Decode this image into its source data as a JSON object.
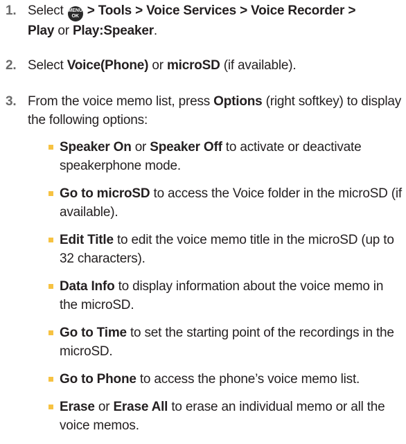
{
  "steps": [
    {
      "number": "1.",
      "pre": "Select",
      "menu_icon_label_top": "MENU",
      "menu_icon_label_bottom": "OK",
      "path": " > Tools > Voice Services > Voice Recorder >",
      "option1": "Play",
      "or": " or ",
      "option2": "Play:Speaker",
      "end": "."
    },
    {
      "number": "2.",
      "pre": "Select ",
      "option1": "Voice(Phone)",
      "or": " or ",
      "option2": "microSD",
      "end": " (if available)."
    },
    {
      "number": "3.",
      "pre": "From the voice memo list, press ",
      "key": "Options",
      "end": " (right softkey) to display the  following options:"
    }
  ],
  "options": [
    {
      "bold": "Speaker On",
      "mid": " or ",
      "bold2": "Speaker Off",
      "text": " to activate or deactivate speakerphone mode."
    },
    {
      "bold": "Go to microSD",
      "mid": "",
      "bold2": "",
      "text": " to access the Voice folder in the microSD (if available)."
    },
    {
      "bold": "Edit Title",
      "mid": "",
      "bold2": "",
      "text": " to edit the voice memo title in the microSD (up to 32 characters)."
    },
    {
      "bold": "Data Info",
      "mid": "",
      "bold2": "",
      "text": " to display information about the voice memo in the microSD."
    },
    {
      "bold": "Go to Time",
      "mid": "",
      "bold2": "",
      "text": " to set the starting point of the recordings in the microSD."
    },
    {
      "bold": "Go to Phone",
      "mid": "",
      "bold2": "",
      "text": " to access the phone’s voice memo list."
    },
    {
      "bold": "Erase",
      "mid": " or ",
      "bold2": "Erase All",
      "text": " to erase an individual memo or all the voice memos."
    }
  ],
  "colors": {
    "text": "#231f20",
    "step_number": "#6a6a6a",
    "bullet": "#f6c242",
    "menu_icon": "#2a2a2a"
  }
}
